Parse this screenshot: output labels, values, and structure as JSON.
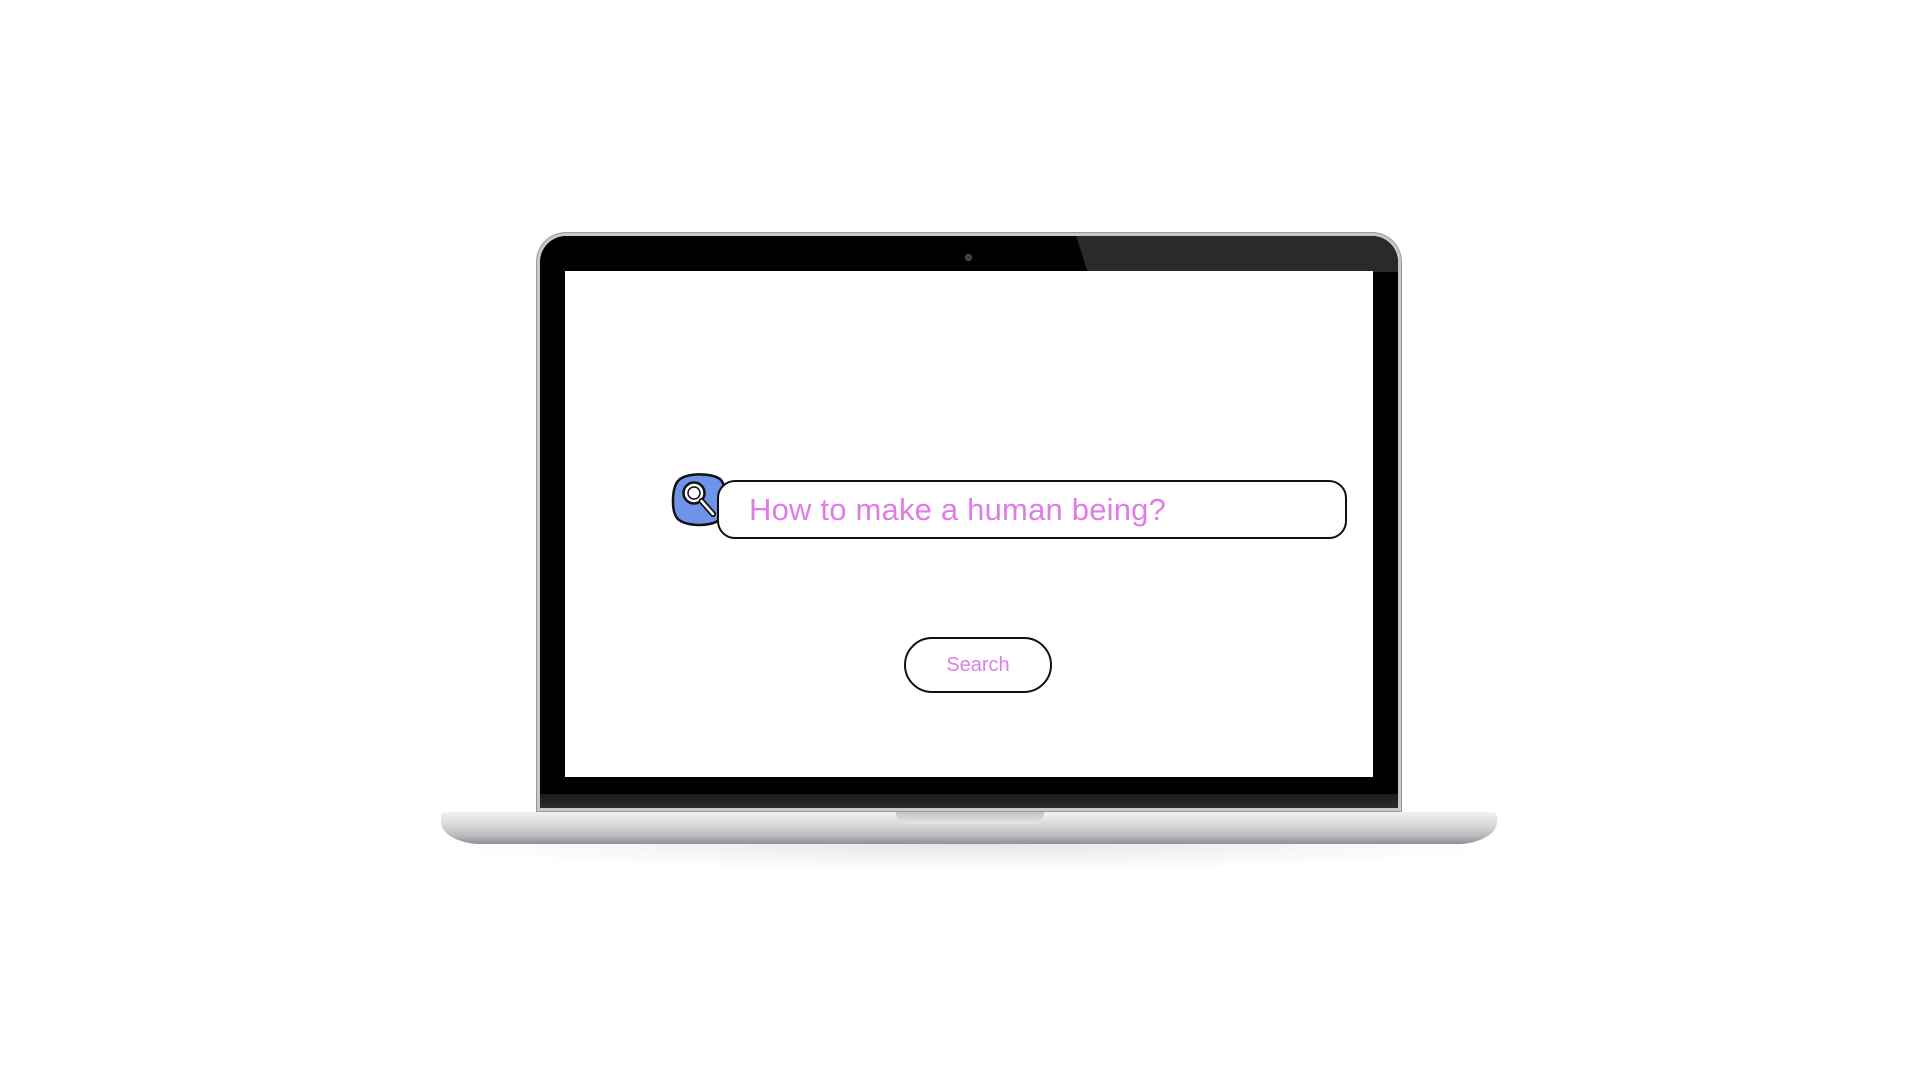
{
  "search": {
    "query": "How to make a human being?",
    "button_label": "Search",
    "icon": "magnifier-icon"
  },
  "colors": {
    "accent_text": "#e07ce8",
    "icon_fill": "#6f93e8",
    "outline": "#111111",
    "bezel": "#000000"
  }
}
